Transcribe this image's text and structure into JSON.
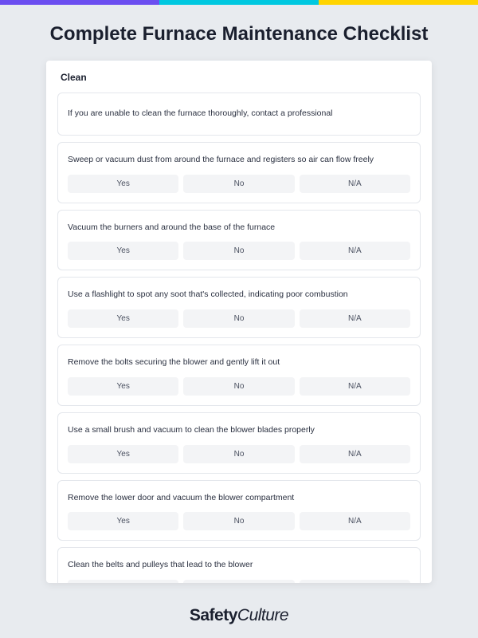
{
  "title": "Complete Furnace Maintenance Checklist",
  "section": "Clean",
  "options": {
    "yes": "Yes",
    "no": "No",
    "na": "N/A"
  },
  "items": [
    {
      "text": "If you are unable to clean the furnace thoroughly, contact a professional",
      "hasOptions": false
    },
    {
      "text": "Sweep or vacuum dust from around the furnace and registers so air can flow freely",
      "hasOptions": true
    },
    {
      "text": "Vacuum the burners and around the base of the furnace",
      "hasOptions": true
    },
    {
      "text": "Use a flashlight to spot any soot that's collected, indicating poor combustion",
      "hasOptions": true
    },
    {
      "text": "Remove the bolts securing the blower and gently lift it out",
      "hasOptions": true
    },
    {
      "text": "Use a small brush and vacuum to clean the blower blades properly",
      "hasOptions": true
    },
    {
      "text": "Remove the lower door and vacuum the blower compartment",
      "hasOptions": true
    },
    {
      "text": "Clean the belts and pulleys that lead to the blower",
      "hasOptions": true
    }
  ],
  "logo": {
    "part1": "Safety",
    "part2": "Culture"
  }
}
